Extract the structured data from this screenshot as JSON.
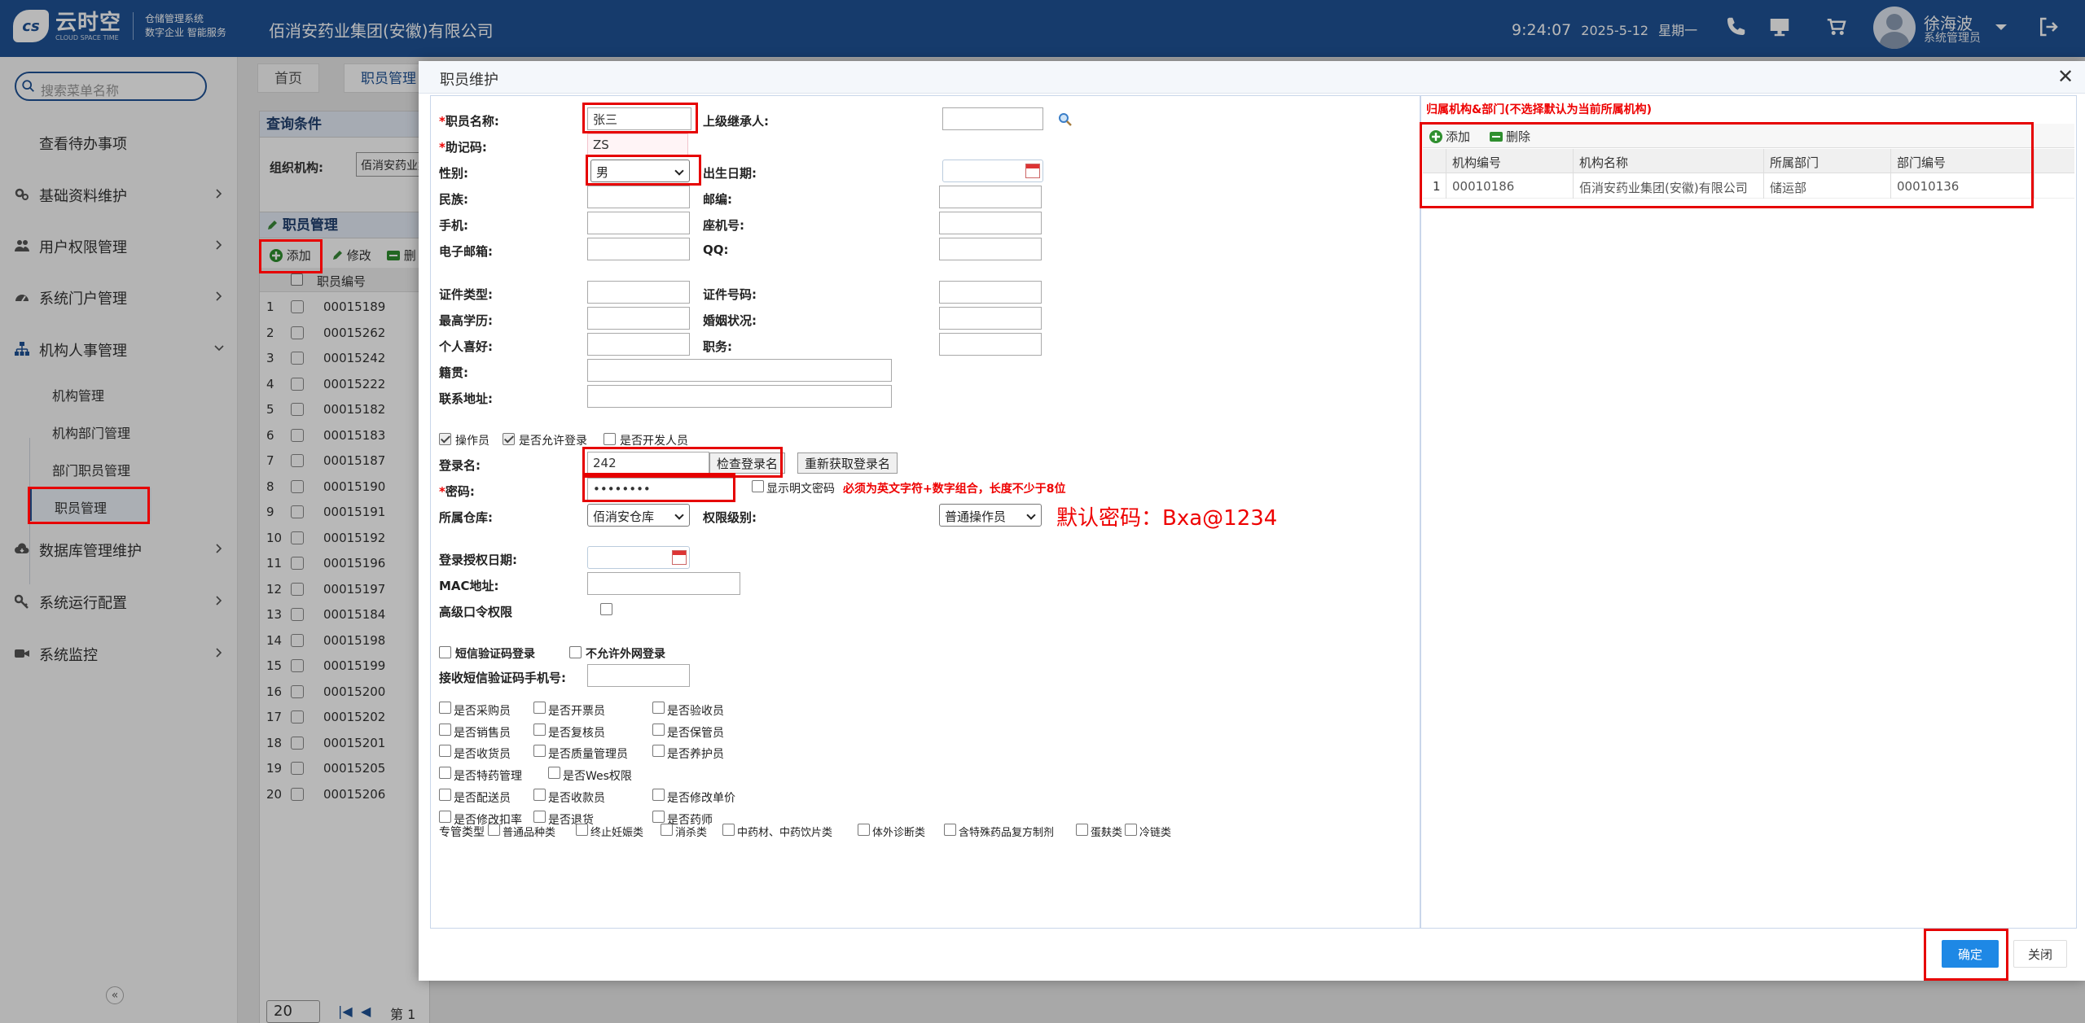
{
  "header": {
    "logo_name": "云时空",
    "logo_sub": "CLOUD SPACE TIME",
    "logo_desc1": "仓储管理系统",
    "logo_desc2": "数字企业 智能服务",
    "company": "佰消安药业集团(安徽)有限公司",
    "time": "9:24:07",
    "date": "2025-5-12",
    "weekday": "星期一",
    "user_name": "徐海波",
    "user_role": "系统管理员"
  },
  "sidebar": {
    "search_placeholder": "搜索菜单名称",
    "todo": "查看待办事项",
    "items": [
      {
        "label": "基础资料维护",
        "icon": "gears-icon"
      },
      {
        "label": "用户权限管理",
        "icon": "users-icon"
      },
      {
        "label": "系统门户管理",
        "icon": "dashboard-icon"
      },
      {
        "label": "机构人事管理",
        "icon": "org-chart-icon"
      },
      {
        "label": "数据库管理维护",
        "icon": "cloud-download-icon"
      },
      {
        "label": "系统运行配置",
        "icon": "key-icon"
      },
      {
        "label": "系统监控",
        "icon": "video-camera-icon"
      }
    ],
    "sub_items": [
      "机构管理",
      "机构部门管理",
      "部门职员管理",
      "职员管理"
    ]
  },
  "background": {
    "tabs": [
      "首页",
      "职员管理"
    ],
    "query_title": "查询条件",
    "org_label": "组织机构:",
    "org_value": "佰消安药业集团",
    "grid_title": "职员管理",
    "add_label": "添加",
    "edit_label": "修改",
    "delete_label": "删",
    "col_code": "职员编号",
    "rows": [
      "00015189",
      "00015262",
      "00015242",
      "00015222",
      "00015182",
      "00015183",
      "00015187",
      "00015190",
      "00015191",
      "00015192",
      "00015196",
      "00015197",
      "00015184",
      "00015198",
      "00015199",
      "00015200",
      "00015202",
      "00015201",
      "00015205",
      "00015206"
    ],
    "page_size": "20",
    "page_label": "第 1"
  },
  "dialog": {
    "title": "职员维护",
    "labels": {
      "name": "职员名称:",
      "mnemonic": "助记码:",
      "gender": "性别:",
      "nation": "民族:",
      "mobile": "手机:",
      "email": "电子邮箱:",
      "superior": "上级继承人:",
      "birth": "出生日期:",
      "postcode": "邮编:",
      "landline": "座机号:",
      "qq": "QQ:",
      "id_type": "证件类型:",
      "id_no": "证件号码:",
      "education": "最高学历:",
      "marital": "婚姻状况:",
      "hobby": "个人喜好:",
      "position": "职务:",
      "native_place": "籍贯:",
      "address": "联系地址:",
      "login_name": "登录名:",
      "password": "密码:",
      "warehouse": "所属仓库:",
      "permission_level": "权限级别:",
      "auth_date": "登录授权日期:",
      "mac": "MAC地址:",
      "advanced_pwd": "高级口令权限",
      "sms_phone": "接收短信验证码手机号:",
      "special_type": "专管类型"
    },
    "values": {
      "name": "张三",
      "mnemonic": "ZS",
      "gender": "男",
      "login_name": "242",
      "password": "••••••••",
      "warehouse": "佰消安仓库",
      "permission_level": "普通操作员"
    },
    "flags": [
      "操作员",
      "是否允许登录",
      "是否开发人员"
    ],
    "check_login_btn": "检查登录名",
    "regen_login_btn": "重新获取登录名",
    "show_password": "显示明文密码",
    "password_rule": "必须为英文字符+数字组合，长度不少于8位",
    "default_password_note": "默认密码：Bxa@1234",
    "sms_login": "短信验证码登录",
    "no_external": "不允许外网登录",
    "roles": [
      [
        "是否采购员",
        "是否开票员",
        "是否验收员"
      ],
      [
        "是否销售员",
        "是否复核员",
        "是否保管员"
      ],
      [
        "是否收货员",
        "是否质量管理员",
        "是否养护员"
      ],
      [
        "是否特药管理",
        "是否Wes权限"
      ],
      [
        "是否配送员",
        "是否收款员",
        "是否修改单价"
      ],
      [
        "是否修改扣率",
        "是否退货",
        "是否药师"
      ]
    ],
    "special_types": [
      "普通品种类",
      "终止妊娠类",
      "消杀类",
      "中药材、中药饮片类",
      "体外诊断类",
      "含特殊药品复方制剂",
      "蛋麸类",
      "冷链类"
    ],
    "right": {
      "title": "归属机构&部门(不选择默认为当前所属机构)",
      "add": "添加",
      "delete": "删除",
      "headers": [
        "机构编号",
        "机构名称",
        "所属部门",
        "部门编号"
      ],
      "row": {
        "index": "1",
        "code": "00010186",
        "name": "佰消安药业集团(安徽)有限公司",
        "dept": "储运部",
        "dept_code": "00010136"
      }
    },
    "ok": "确定",
    "close": "关闭"
  },
  "colors": {
    "header": "#1f5396",
    "highlight": "#e60000",
    "primary": "#1e88e5"
  }
}
